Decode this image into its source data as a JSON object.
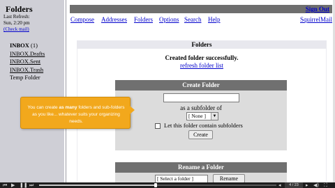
{
  "left_pane": {
    "title": "Folders",
    "last_refresh_label": "Last Refresh:",
    "last_refresh_value": "Sun, 2:20 pm",
    "check_mail": "(Check mail)",
    "folders": {
      "inbox": "INBOX",
      "inbox_count": "(1)",
      "drafts": "INBOX.Drafts",
      "sent": "INBOX.Sent",
      "trash": "INBOX.Trash",
      "temp": "Temp Folder"
    }
  },
  "top_bar": {
    "sign_out": "Sign Out"
  },
  "menu": {
    "compose": "Compose",
    "addresses": "Addresses",
    "folders": "Folders",
    "options": "Options",
    "search": "Search",
    "help": "Help",
    "brand": "SquirrelMail"
  },
  "main": {
    "header": "Folders",
    "success_message": "Created folder successfully.",
    "refresh_link": "refresh folder list"
  },
  "create_folder": {
    "title": "Create Folder",
    "name_value": "",
    "subfolder_label": "as a subfolder of",
    "subfolder_selected": "[ None ]",
    "contain_subfolders_label": "Let this folder contain subfolders",
    "contain_subfolders_checked": false,
    "create_button": "Create"
  },
  "rename_folder": {
    "title": "Rename a Folder",
    "select_value": "[ Select a folder ]",
    "rename_button": "Rename"
  },
  "tooltip": {
    "text_before": "You can create ",
    "text_bold": "as many",
    "text_after": " folders and sub-folders as you like... whatever suits your organizing needs."
  },
  "player": {
    "slide_counter": "4 / 23",
    "progress_fraction": 0.49
  },
  "colors": {
    "left_pane_bg": "#cfcfd6",
    "top_bar_bg": "#6e6e6e",
    "panel_title_bg": "#707070",
    "panel_bg": "#dcdcdc",
    "link": "#0000cc",
    "tooltip_bg": "#f2a81c"
  }
}
